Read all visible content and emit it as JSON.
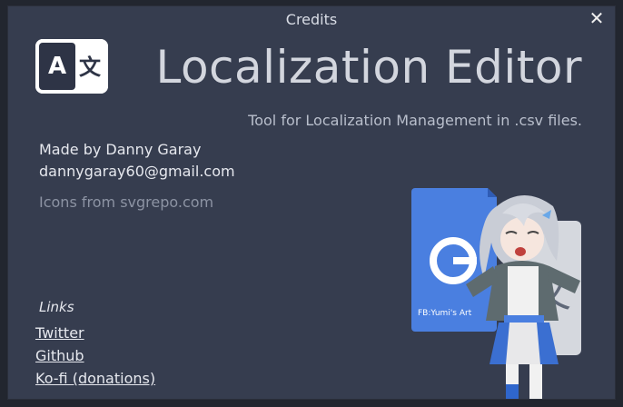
{
  "window": {
    "title": "Credits",
    "close_symbol": "✕"
  },
  "app": {
    "name": "Localization Editor",
    "tagline": "Tool for Localization Management in .csv files."
  },
  "credits": {
    "made_by": "Made by Danny Garay",
    "email": "dannygaray60@gmail.com",
    "icons": "Icons from svgrepo.com"
  },
  "links": {
    "heading": "Links",
    "items": [
      "Twitter",
      "Github",
      "Ko-fi (donations)"
    ]
  },
  "artwork": {
    "watermark": "FB:Yumi's Art"
  },
  "colors": {
    "dialog_bg": "#363d4f",
    "accent_blue": "#4a7fe0",
    "text": "#e6e8ee"
  }
}
